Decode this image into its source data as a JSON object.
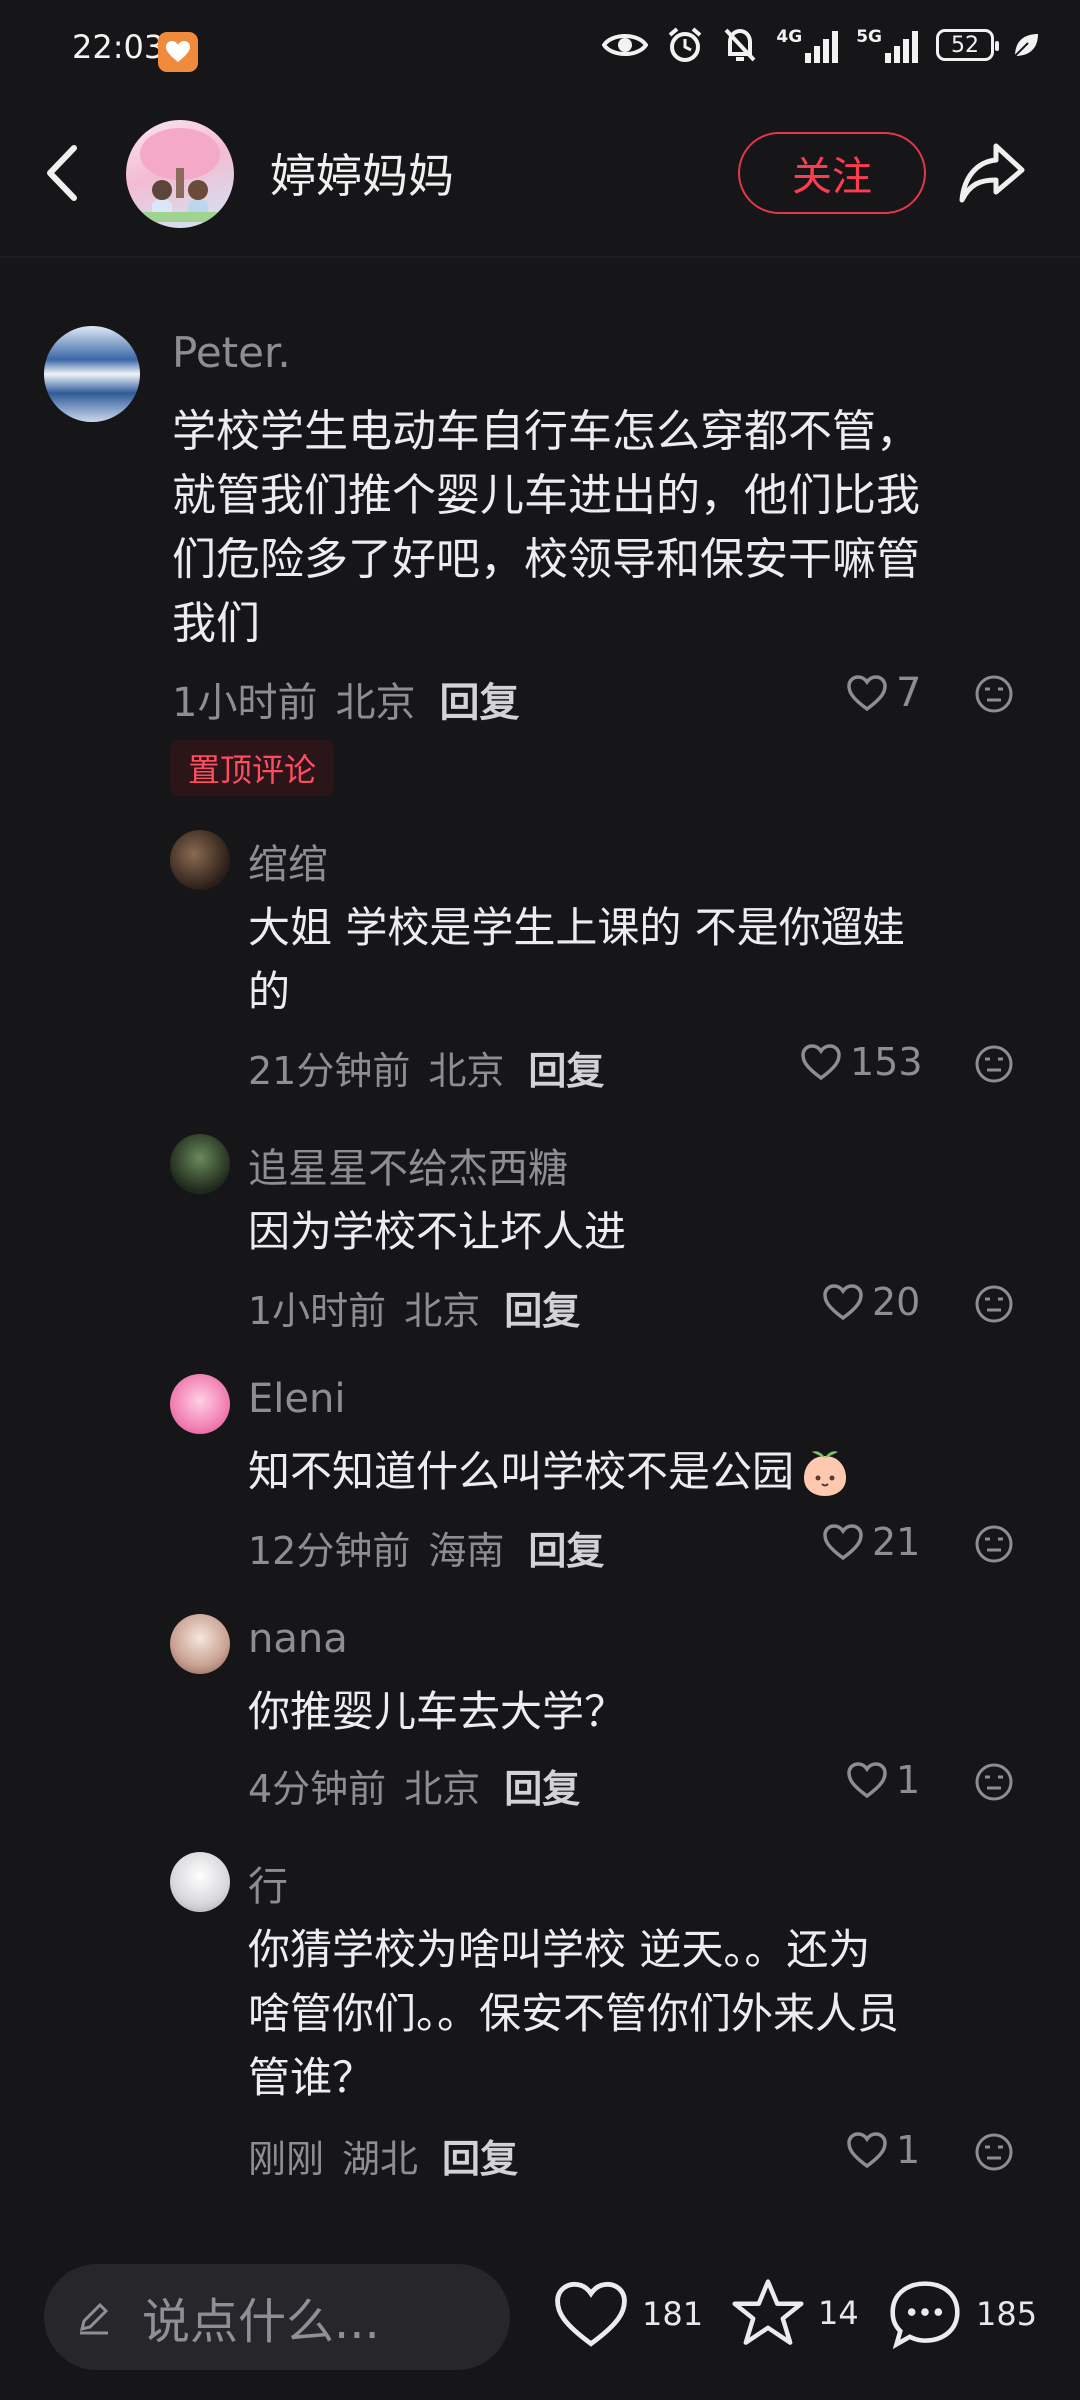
{
  "status_bar": {
    "time": "22:03",
    "signal1_label": "4G",
    "signal2_label": "5G",
    "battery": "52"
  },
  "header": {
    "title": "婷婷妈妈",
    "follow_label": "关注"
  },
  "main_comment": {
    "user": "Peter.",
    "text_lines": [
      "学校学生电动车自行车怎么穿都不管，",
      "就管我们推个婴儿车进出的，他们比我",
      "们危险多了好吧，校领导和保安干嘛管",
      "我们"
    ],
    "time": "1小时前",
    "location": "北京",
    "reply_label": "回复",
    "likes": "7",
    "pinned_label": "置顶评论"
  },
  "replies": [
    {
      "user": "绾绾",
      "text_lines": [
        "大姐 学校是学生上课的 不是你遛娃",
        "的"
      ],
      "time": "21分钟前",
      "location": "北京",
      "reply_label": "回复",
      "likes": "153"
    },
    {
      "user": "追星星不给杰西糖",
      "text_lines": [
        "因为学校不让坏人进"
      ],
      "time": "1小时前",
      "location": "北京",
      "reply_label": "回复",
      "likes": "20"
    },
    {
      "user": "Eleni",
      "text_lines": [
        "知不知道什么叫学校不是公园"
      ],
      "time": "12分钟前",
      "location": "海南",
      "reply_label": "回复",
      "likes": "21"
    },
    {
      "user": "nana",
      "text_lines": [
        "你推婴儿车去大学？"
      ],
      "time": "4分钟前",
      "location": "北京",
      "reply_label": "回复",
      "likes": "1"
    },
    {
      "user": "行",
      "text_lines": [
        "你猜学校为啥叫学校 逆天。。还为",
        "啥管你们。。保安不管你们外来人员",
        "管谁？"
      ],
      "time": "刚刚",
      "location": "湖北",
      "reply_label": "回复",
      "likes": "1"
    }
  ],
  "bottom_bar": {
    "input_placeholder": "说点什么...",
    "like_count": "181",
    "star_count": "14",
    "comment_count": "185"
  },
  "colors": {
    "background": "#161619",
    "accent": "#ff3b4f",
    "muted_text": "#8d8d93"
  }
}
